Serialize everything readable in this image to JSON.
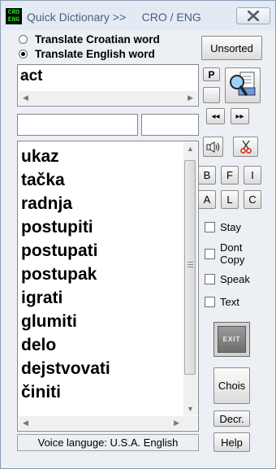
{
  "window": {
    "icon_top": "CRO",
    "icon_bottom": "ENG",
    "title": "Quick Dictionary >>     CRO / ENG",
    "close_symbol": "X"
  },
  "direction": {
    "options": [
      {
        "label": "Translate Croatian word",
        "selected": false
      },
      {
        "label": "Translate English word",
        "selected": true
      }
    ]
  },
  "search": {
    "value": "act"
  },
  "buttons": {
    "unsorted": "Unsorted",
    "p": "P",
    "prev": "◂◂",
    "next": "▸▸",
    "b": "B",
    "f": "F",
    "i": "I",
    "a": "A",
    "l": "L",
    "c": "C",
    "exit": "EXIT",
    "chois": "Chois",
    "decr": "Decr.",
    "help": "Help"
  },
  "results": [
    "ukaz",
    "tačka",
    "radnja",
    "postupiti",
    "postupati",
    "postupak",
    "igrati",
    "glumiti",
    "delo",
    "dejstvovati",
    "činiti"
  ],
  "options": {
    "stay": "Stay",
    "dont_copy_1": "Dont",
    "dont_copy_2": "Copy",
    "speak": "Speak",
    "text": "Text"
  },
  "status": {
    "voice": "Voice languge: U.S.A. English"
  }
}
